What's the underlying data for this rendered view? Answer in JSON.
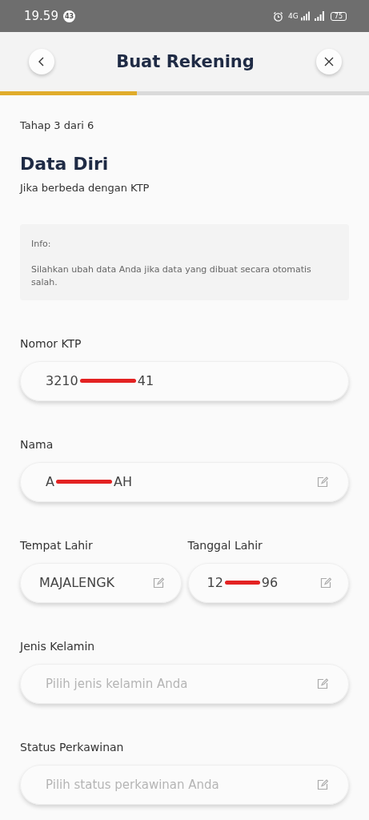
{
  "status_bar": {
    "time": "19.59",
    "notification_count": "43",
    "network": "4G",
    "battery": "75"
  },
  "header": {
    "title": "Buat Rekening"
  },
  "progress": {
    "level": 0.37
  },
  "step": "Tahap 3 dari 6",
  "heading": "Data Diri",
  "subtitle": "Jika berbeda dengan KTP",
  "info": {
    "title": "Info:",
    "text": "Silahkan ubah data Anda jika data yang dibuat secara otomatis salah."
  },
  "field_rows": [
    [
      {
        "label": "Nomor KTP",
        "kind": "value",
        "before": "3210",
        "after": "41",
        "redacted": true,
        "editable": false
      }
    ],
    [
      {
        "label": "Nama",
        "kind": "value",
        "before": "A",
        "after": "AH",
        "redacted": true,
        "editable": true
      }
    ],
    [
      {
        "label": "Tempat Lahir",
        "kind": "value",
        "before": "MAJALENGK",
        "redacted": false,
        "editable": true
      },
      {
        "label": "Tanggal Lahir",
        "kind": "value",
        "before": "12",
        "after": "96",
        "redacted": true,
        "editable": true
      }
    ],
    [
      {
        "label": "Jenis Kelamin",
        "kind": "placeholder",
        "placeholder": "Pilih jenis kelamin Anda",
        "editable": true
      }
    ],
    [
      {
        "label": "Status Perkawinan",
        "kind": "placeholder",
        "placeholder": "Pilih status perkawinan Anda",
        "editable": true
      }
    ]
  ]
}
